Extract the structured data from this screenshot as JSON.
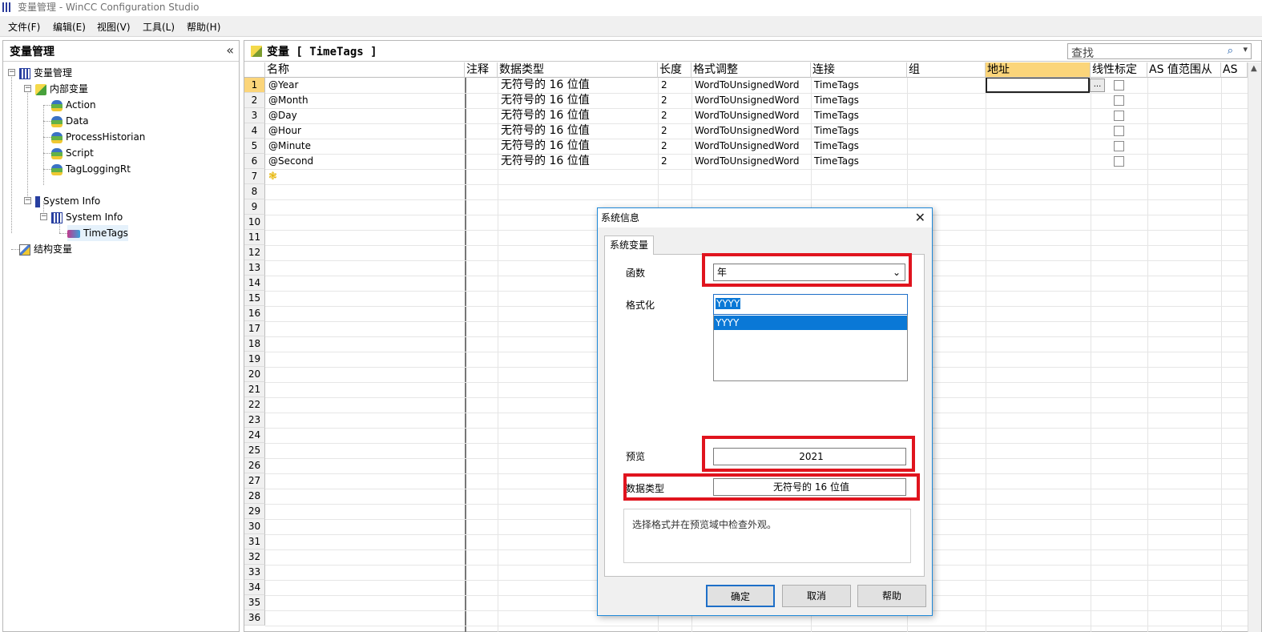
{
  "window": {
    "title": "变量管理 - WinCC Configuration Studio"
  },
  "menu": [
    "文件(F)",
    "编辑(E)",
    "视图(V)",
    "工具(L)",
    "帮助(H)"
  ],
  "left": {
    "title": "变量管理",
    "collapse": "«",
    "tree": {
      "root": "变量管理",
      "internal": "内部变量",
      "children": [
        "Action",
        "Data",
        "ProcessHistorian",
        "Script",
        "TagLoggingRt"
      ],
      "sysinfo": "System Info",
      "sysinfo_child": "System Info",
      "timetags": "TimeTags",
      "struct": "结构变量"
    }
  },
  "right": {
    "title": "变量 [ TimeTags ]",
    "search_placeholder": "查找",
    "columns": [
      "名称",
      "注释",
      "数据类型",
      "长度",
      "格式调整",
      "连接",
      "组",
      "地址",
      "线性标定",
      "AS 值范围从",
      "AS"
    ],
    "rows": [
      {
        "num": "1",
        "name": "@Year",
        "type": "无符号的 16 位值",
        "len": "2",
        "fmt": "WordToUnsignedWord",
        "conn": "TimeTags"
      },
      {
        "num": "2",
        "name": "@Month",
        "type": "无符号的 16 位值",
        "len": "2",
        "fmt": "WordToUnsignedWord",
        "conn": "TimeTags"
      },
      {
        "num": "3",
        "name": "@Day",
        "type": "无符号的 16 位值",
        "len": "2",
        "fmt": "WordToUnsignedWord",
        "conn": "TimeTags"
      },
      {
        "num": "4",
        "name": "@Hour",
        "type": "无符号的 16 位值",
        "len": "2",
        "fmt": "WordToUnsignedWord",
        "conn": "TimeTags"
      },
      {
        "num": "5",
        "name": "@Minute",
        "type": "无符号的 16 位值",
        "len": "2",
        "fmt": "WordToUnsignedWord",
        "conn": "TimeTags"
      },
      {
        "num": "6",
        "name": "@Second",
        "type": "无符号的 16 位值",
        "len": "2",
        "fmt": "WordToUnsignedWord",
        "conn": "TimeTags"
      }
    ],
    "row_numbers": [
      "1",
      "2",
      "3",
      "4",
      "5",
      "6",
      "7",
      "8",
      "9",
      "10",
      "11",
      "12",
      "13",
      "14",
      "15",
      "16",
      "17",
      "18",
      "19",
      "20",
      "21",
      "22",
      "23",
      "24",
      "25",
      "26",
      "27",
      "28",
      "29",
      "30",
      "31",
      "32",
      "33",
      "34",
      "35",
      "36"
    ],
    "addr_button": "..."
  },
  "dialog": {
    "title": "系统信息",
    "tab": "系统变量",
    "function_label": "函数",
    "function_value": "年",
    "format_label": "格式化",
    "format_value": "YYYY",
    "format_option": "YYYY",
    "preview_label": "预览",
    "preview_value": "2021",
    "datatype_label": "数据类型",
    "datatype_value": "无符号的 16 位值",
    "description": "选择格式并在预览域中检查外观。",
    "ok": "确定",
    "cancel": "取消",
    "help": "帮助"
  },
  "colors": {
    "selection": "#0a78d6",
    "highlight_header": "#fbd57a",
    "red_box": "#e0141e"
  }
}
